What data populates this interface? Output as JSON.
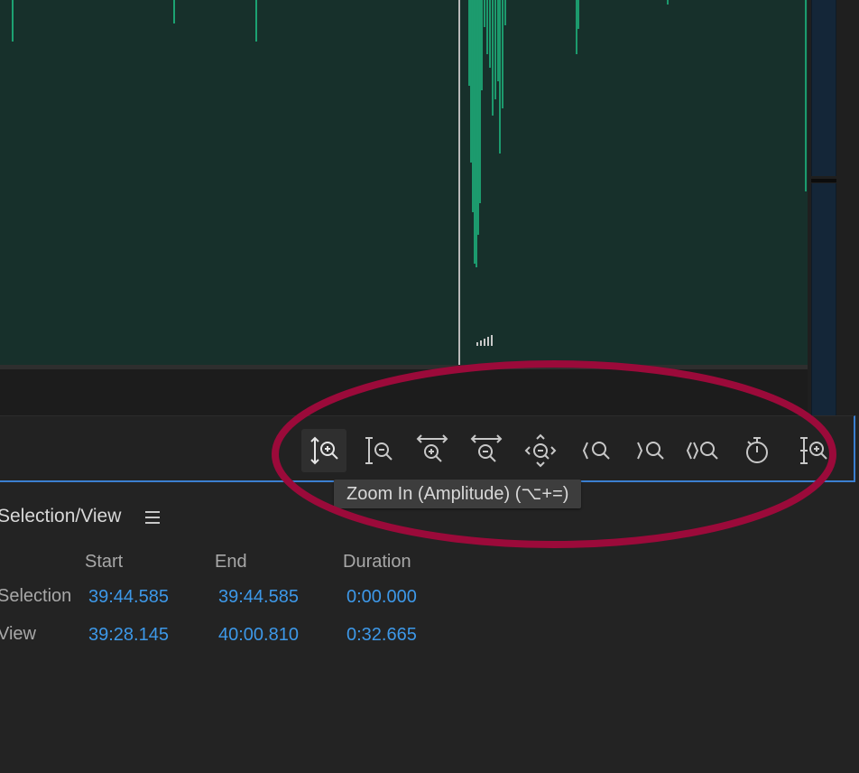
{
  "colors": {
    "waveform_bg": "#17302b",
    "waveform_green": "#1fc98a",
    "panel_bg": "#232323",
    "accent_blue": "#3b7fd0",
    "timecode_blue": "#3d98e8",
    "annotation_red": "#9b0a3a"
  },
  "toolbar": {
    "buttons": [
      {
        "name": "zoom-in-amplitude-icon"
      },
      {
        "name": "zoom-out-amplitude-icon"
      },
      {
        "name": "zoom-in-time-icon"
      },
      {
        "name": "zoom-out-time-icon"
      },
      {
        "name": "zoom-out-full-icon"
      },
      {
        "name": "zoom-to-selection-in-point-icon"
      },
      {
        "name": "zoom-to-selection-out-point-icon"
      },
      {
        "name": "zoom-to-selection-icon"
      },
      {
        "name": "zoom-playhead-icon"
      },
      {
        "name": "zoom-amplitude-alt-icon"
      }
    ],
    "tooltip": "Zoom In (Amplitude) (⌥+=)"
  },
  "panel": {
    "title": "Selection/View",
    "menu_icon": "hamburger-menu-icon",
    "columns": [
      "Start",
      "End",
      "Duration"
    ],
    "rows": [
      {
        "label": "Selection",
        "start": "39:44.585",
        "end": "39:44.585",
        "duration": "0:00.000"
      },
      {
        "label": "View",
        "start": "39:28.145",
        "end": "40:00.810",
        "duration": "0:32.665"
      }
    ]
  }
}
